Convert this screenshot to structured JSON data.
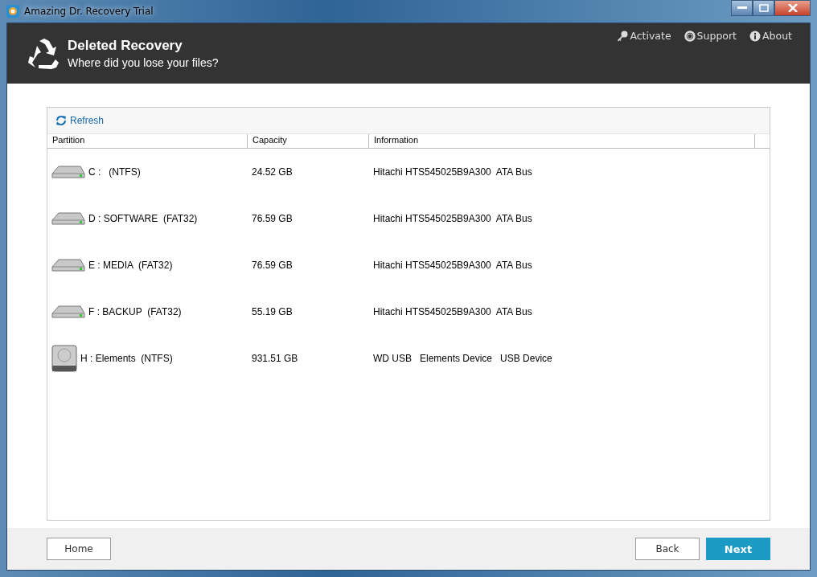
{
  "window": {
    "title": "Amazing Dr. Recovery Trial"
  },
  "header": {
    "title": "Deleted Recovery",
    "subtitle": "Where did you lose your files?",
    "links": [
      {
        "kind": "key",
        "label": "Activate"
      },
      {
        "kind": "lifebuoy",
        "label": "Support"
      },
      {
        "kind": "info",
        "label": "About"
      }
    ]
  },
  "toolbar": {
    "refresh": "Refresh"
  },
  "table": {
    "columns": [
      "Partition",
      "Capacity",
      "Information"
    ],
    "rows": [
      {
        "kind": "internal",
        "partition": "C :   (NTFS)",
        "capacity": "24.52 GB",
        "information": "Hitachi HTS545025B9A300  ATA Bus"
      },
      {
        "kind": "internal",
        "partition": "D : SOFTWARE  (FAT32)",
        "capacity": "76.59 GB",
        "information": "Hitachi HTS545025B9A300  ATA Bus"
      },
      {
        "kind": "internal",
        "partition": "E : MEDIA  (FAT32)",
        "capacity": "76.59 GB",
        "information": "Hitachi HTS545025B9A300  ATA Bus"
      },
      {
        "kind": "internal",
        "partition": "F : BACKUP  (FAT32)",
        "capacity": "55.19 GB",
        "information": "Hitachi HTS545025B9A300  ATA Bus"
      },
      {
        "kind": "external",
        "partition": "H : Elements  (NTFS)",
        "capacity": "931.51 GB",
        "information": "WD USB   Elements Device   USB Device"
      }
    ]
  },
  "footer": {
    "home": "Home",
    "back": "Back",
    "next": "Next"
  }
}
